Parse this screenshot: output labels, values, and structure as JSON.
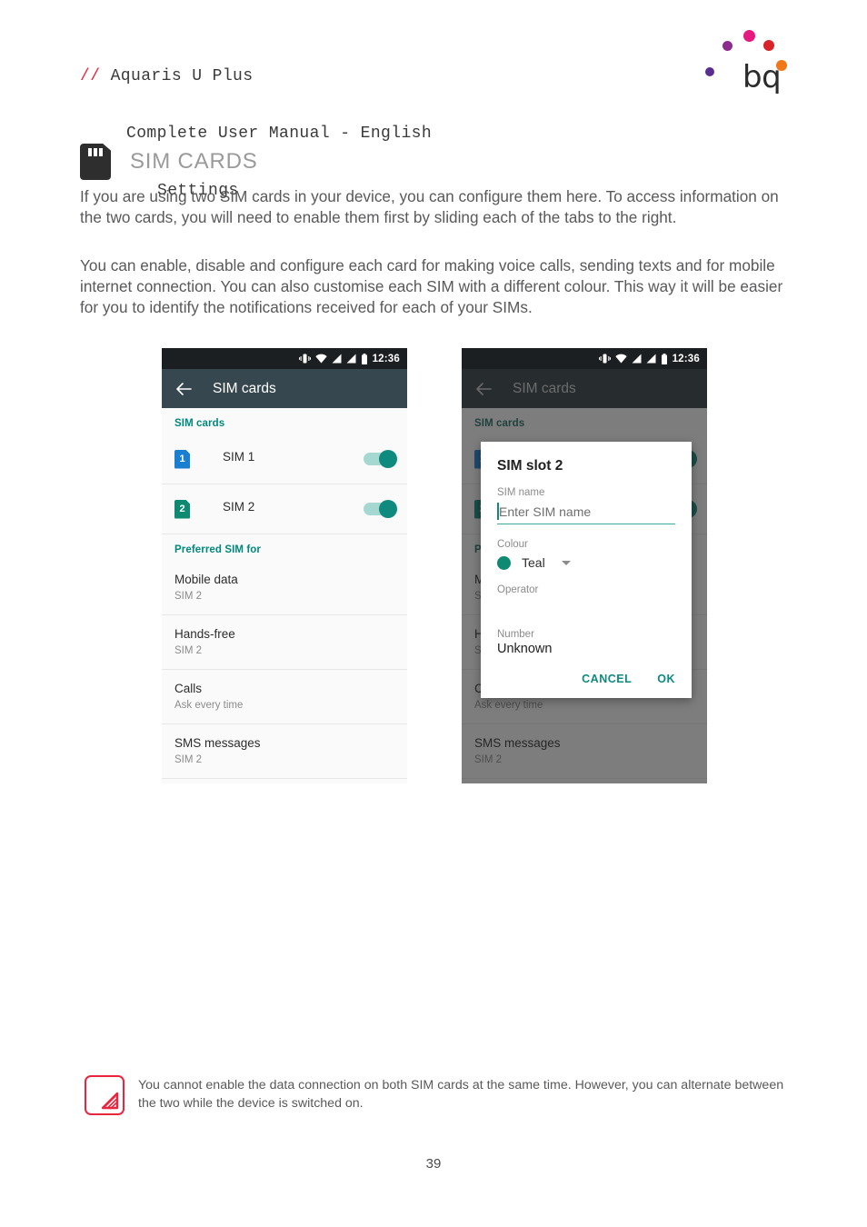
{
  "header": {
    "slashes": "// ",
    "line1": "Aquaris U Plus",
    "line2": "Complete User Manual - English",
    "line3": "Settings"
  },
  "logo": {
    "wordmark": "bq",
    "dot_colors": [
      "#8e2b8e",
      "#e5197f",
      "#d8232a",
      "#f07818",
      "#5b2d8e"
    ]
  },
  "section": {
    "title": "SIM CARDS",
    "icon": "sim-card-icon"
  },
  "paragraphs": {
    "p1": "If you are using two SIM cards in your device, you can configure them here. To access information on the two cards, you will need to enable them first by sliding each of the tabs to the right.",
    "p2": "You can enable, disable and configure each card for making voice calls, sending texts and for mobile internet connection. You can also customise each SIM with a different colour. This way it will be easier for you to identify the notifications received for each of your SIMs."
  },
  "phone": {
    "status": {
      "clock": "12:36",
      "icons": [
        "vibrate-icon",
        "wifi-icon",
        "signal-icon",
        "signal-icon",
        "battery-icon"
      ]
    },
    "appbar": {
      "back": "back-arrow-icon",
      "title": "SIM cards"
    },
    "groups": {
      "sim_cards": "SIM cards",
      "preferred": "Preferred SIM for"
    },
    "sims": [
      {
        "badge": "1",
        "label": "SIM 1",
        "badge_color": "#1b7fd1",
        "enabled": true
      },
      {
        "badge": "2",
        "label": "SIM 2",
        "badge_color": "#0f8a72",
        "enabled": true
      }
    ],
    "preferences": [
      {
        "title": "Mobile data",
        "value": "SIM 2"
      },
      {
        "title": "Hands-free",
        "value": "SIM 2"
      },
      {
        "title": "Calls",
        "value": "Ask every time"
      },
      {
        "title": "SMS messages",
        "value": "SIM 2"
      }
    ]
  },
  "dialog": {
    "title": "SIM slot 2",
    "name_label": "SIM name",
    "name_placeholder": "Enter SIM name",
    "name_value": "",
    "colour_label": "Colour",
    "colour_value": "Teal",
    "colour_hex": "#0f8a72",
    "operator_label": "Operator",
    "operator_value": "",
    "number_label": "Number",
    "number_value": "Unknown",
    "cancel": "CANCEL",
    "ok": "OK"
  },
  "note": {
    "icon": "note-warning-icon",
    "text": "You cannot enable the data connection on both SIM cards at the same time. However, you can alternate between the two while the device is switched on."
  },
  "page_number": "39"
}
